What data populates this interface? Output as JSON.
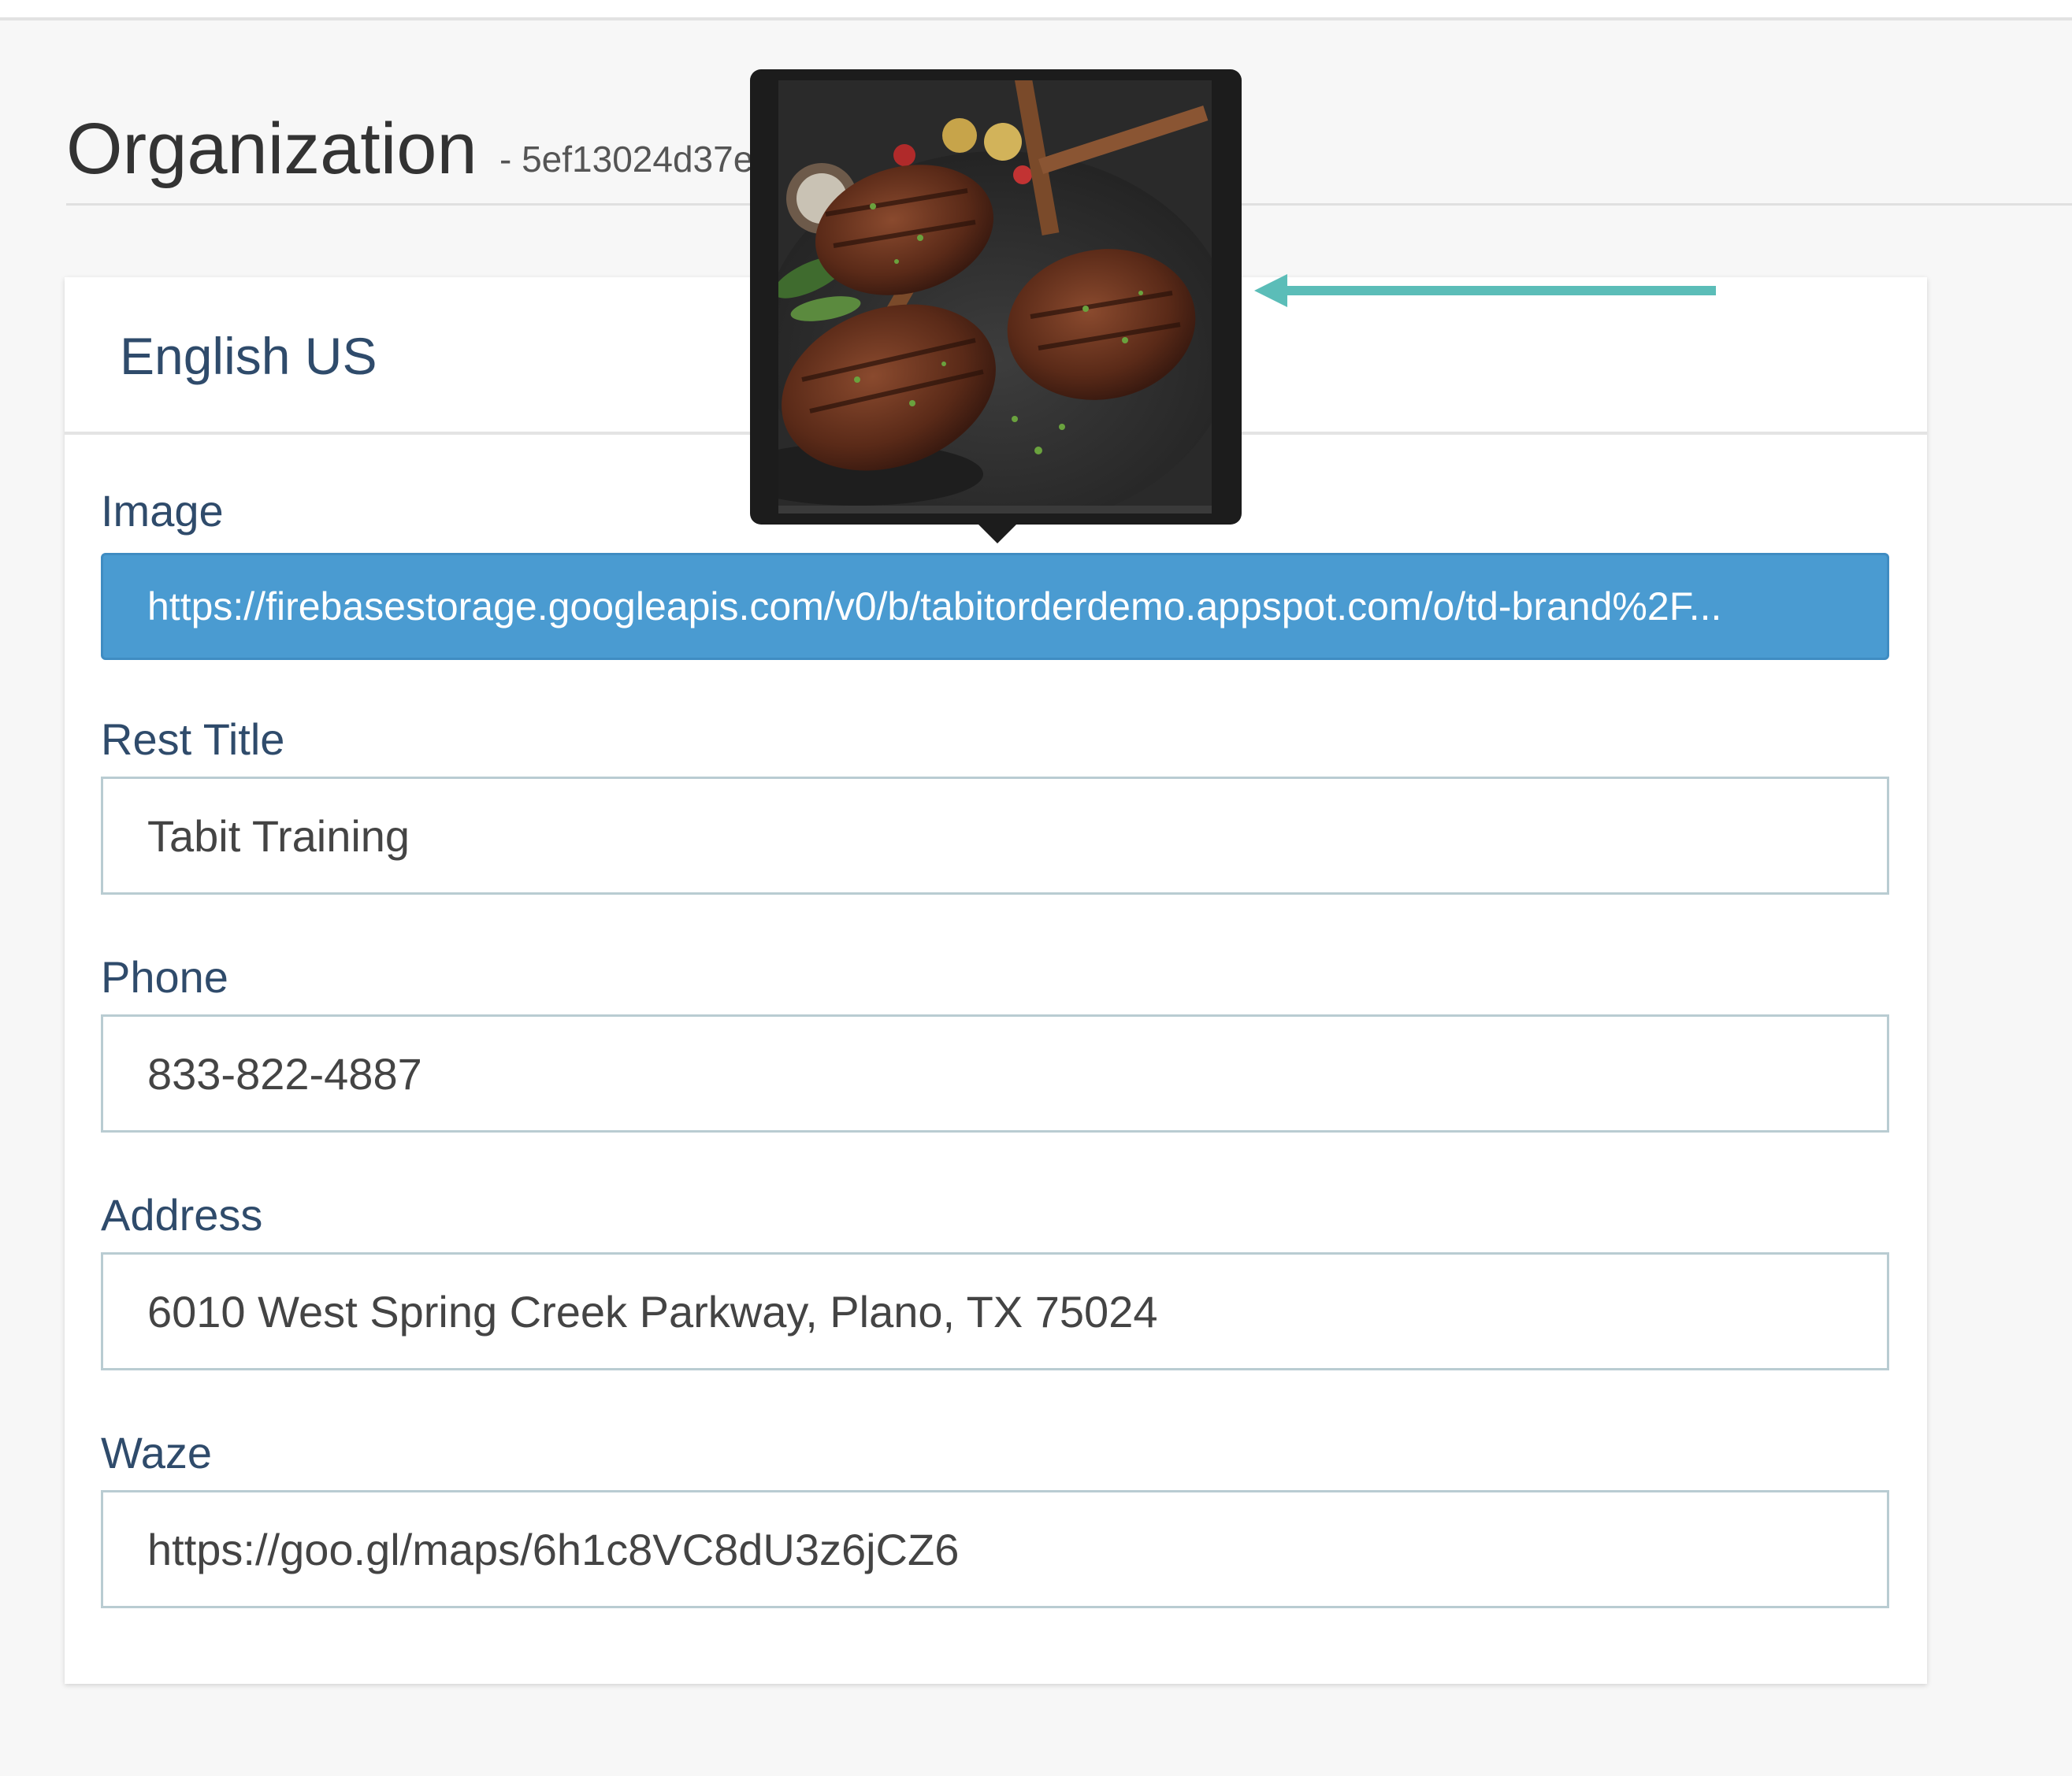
{
  "header": {
    "title": "Organization",
    "org_id": "- 5ef13024d37e"
  },
  "card": {
    "title": "English US"
  },
  "fields": {
    "image": {
      "label": "Image",
      "value": "https://firebasestorage.googleapis.com/v0/b/tabitorderdemo.appspot.com/o/td-brand%2F..."
    },
    "rest_title": {
      "label": "Rest Title",
      "value": "Tabit Training"
    },
    "phone": {
      "label": "Phone",
      "value": "833-822-4887"
    },
    "address": {
      "label": "Address",
      "value": "6010 West Spring Creek Parkway, Plano, TX 75024"
    },
    "waze": {
      "label": "Waze",
      "value": "https://goo.gl/maps/6h1c8VC8dU3z6jCZ6"
    }
  },
  "colors": {
    "selected_field": "#4a9bd1",
    "label_text": "#2f4b6b",
    "annotation_arrow": "#5bbdb8"
  }
}
